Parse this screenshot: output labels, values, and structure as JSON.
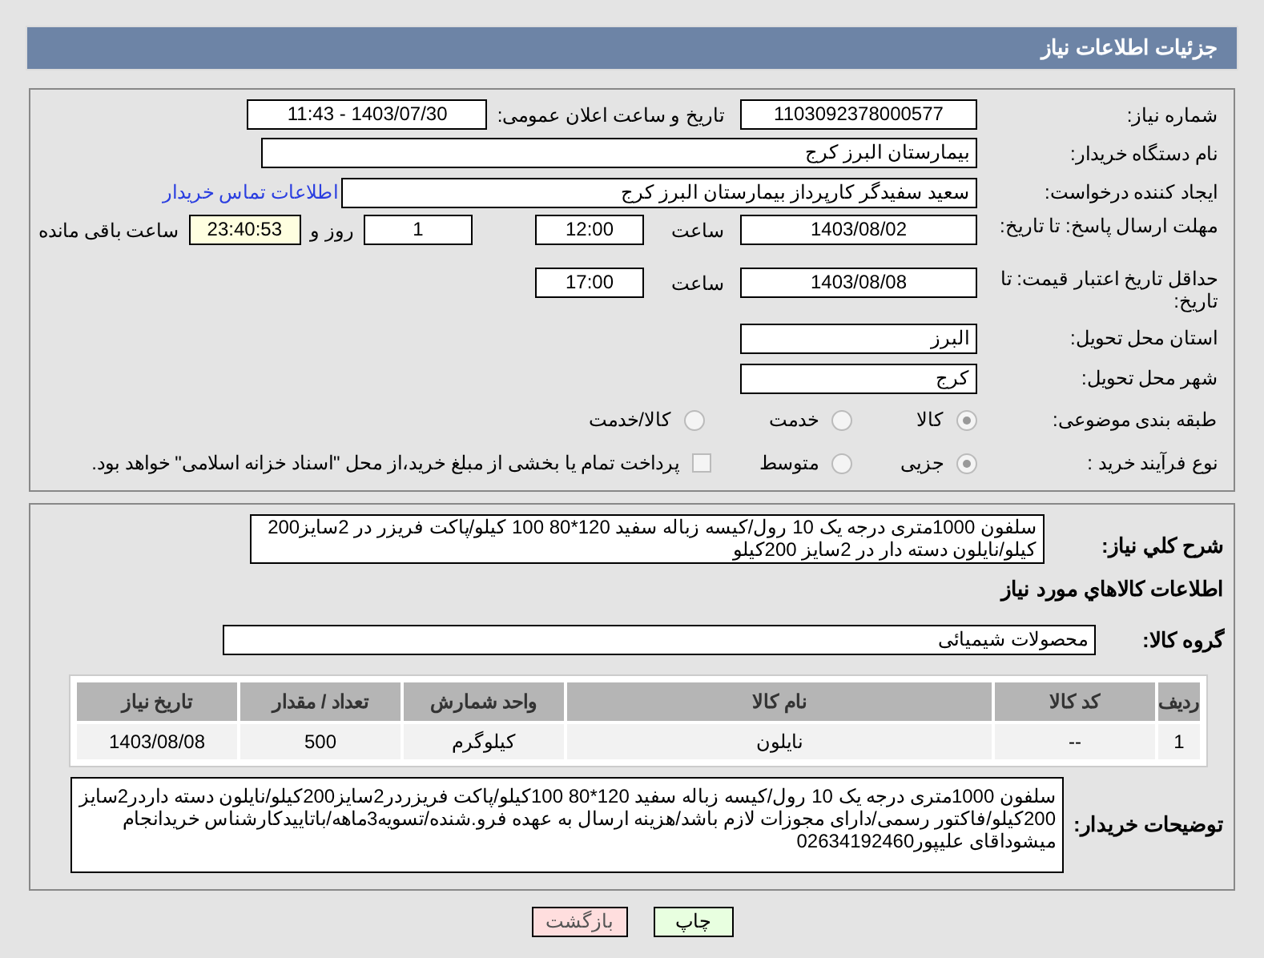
{
  "header": {
    "title": "جزئیات اطلاعات نیاز"
  },
  "need_number": {
    "label": "شماره نیاز:",
    "value": "1103092378000577"
  },
  "announce": {
    "label": "تاریخ و ساعت اعلان عمومی:",
    "value": "1403/07/30 - 11:43"
  },
  "buyer": {
    "label": "نام دستگاه خریدار:",
    "value": "بیمارستان البرز کرج"
  },
  "requester": {
    "label": "ایجاد کننده درخواست:",
    "value": "سعید سفیدگر کارپرداز بیمارستان البرز کرج",
    "link": "اطلاعات تماس خریدار"
  },
  "deadline": {
    "label": "مهلت ارسال پاسخ: تا تاریخ:",
    "date": "1403/08/02",
    "time_label": "ساعت",
    "time": "12:00",
    "days": "1",
    "days_label": "روز و",
    "remaining": "23:40:53",
    "remaining_label": "ساعت باقی مانده"
  },
  "validity": {
    "label": "حداقل تاریخ اعتبار قیمت: تا تاریخ:",
    "date": "1403/08/08",
    "time_label": "ساعت",
    "time": "17:00"
  },
  "province": {
    "label": "استان محل تحویل:",
    "value": "البرز"
  },
  "city": {
    "label": "شهر محل تحویل:",
    "value": "کرج"
  },
  "category": {
    "label": "طبقه بندی موضوعی:",
    "options": [
      {
        "label": "کالا",
        "selected": true
      },
      {
        "label": "خدمت",
        "selected": false
      },
      {
        "label": "کالا/خدمت",
        "selected": false
      }
    ]
  },
  "purchase_type": {
    "label": "نوع فرآیند خرید :",
    "options": [
      {
        "label": "جزیی",
        "selected": true
      },
      {
        "label": "متوسط",
        "selected": false
      }
    ],
    "treasury": {
      "checked": false,
      "text": "پرداخت تمام یا بخشی از مبلغ خرید،از محل \"اسناد خزانه اسلامی\" خواهد بود."
    }
  },
  "summary": {
    "label": "شرح کلي نیاز:",
    "value": "سلفون 1000متری درجه یک 10 رول/کیسه زباله سفید 120*80 100 کیلو/پاکت فریزر در 2سایز200 کیلو/نایلون دسته دار در 2سایز 200کیلو"
  },
  "goods_title": "اطلاعات کالاهاي مورد نیاز",
  "goods_group": {
    "label": "گروه کالا:",
    "value": "محصولات شیمیائی"
  },
  "table": {
    "columns": [
      "ردیف",
      "کد کالا",
      "نام کالا",
      "واحد شمارش",
      "تعداد / مقدار",
      "تاریخ نیاز"
    ],
    "rows": [
      [
        "1",
        "--",
        "نایلون",
        "کیلوگرم",
        "500",
        "1403/08/08"
      ]
    ]
  },
  "notes": {
    "label": "توضیحات خریدار:",
    "value": "سلفون 1000متری درجه یک 10 رول/کیسه زباله سفید 120*80 100کیلو/پاکت فریزردر2سایز200کیلو/نایلون دسته داردر2سایز 200کیلو/فاکتور رسمی/دارای مجوزات لازم باشد/هزینه ارسال به عهده فرو.شنده/تسویه3ماهه/باتاییدکارشناس خریدانجام میشوداقای علیپور02634192460"
  },
  "buttons": [
    {
      "kind": "print",
      "label": "چاپ"
    },
    {
      "kind": "back",
      "label": "بازگشت"
    }
  ]
}
